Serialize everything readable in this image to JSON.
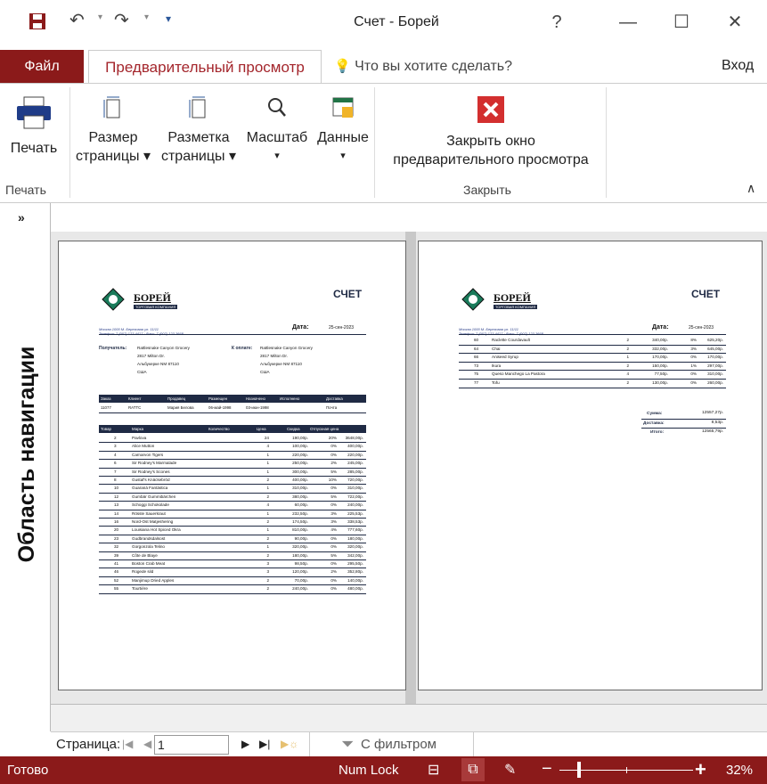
{
  "window": {
    "title": "Счет - Борей",
    "help": "?"
  },
  "tabs": {
    "file": "Файл",
    "preview": "Предварительный просмотр",
    "tell": "Что вы хотите сделать?",
    "signin": "Вход"
  },
  "ribbon": {
    "print": "Печать",
    "size_l1": "Размер",
    "size_l2": "страницы ▾",
    "layout_l1": "Разметка",
    "layout_l2": "страницы ▾",
    "zoom": "Масштаб",
    "data": "Данные",
    "close_l1": "Закрыть окно",
    "close_l2": "предварительного просмотра",
    "group_print": "Печать",
    "group_close": "Закрыть"
  },
  "nav_pane": {
    "label": "Область навигации",
    "toggle": "»"
  },
  "report": {
    "company": "БОРЕЙ",
    "company_sub": "ТОРГОВАЯ КОМПАНИЯ",
    "doc_title": "СЧЕТ",
    "address": "Москва 1000 М. Березовая ул. 11/11",
    "phone": "Телефон: 7 (007) 123 4417 · Факс: 7 (007) 123 3668",
    "date_label": "Дата:",
    "date": "25-сен-2023",
    "ship_label": "Получатель:",
    "bill_label": "К оплате:",
    "customer": [
      "Rattlesnake Canyon Grocery",
      "2817 Milton Dr.",
      "Альбукерке NM 87110",
      "США"
    ],
    "order_headers": [
      "Заказ",
      "Клиент",
      "Продавец",
      "Размещен",
      "Назначено",
      "Исполнено",
      "Доставка"
    ],
    "order_values": [
      "11077",
      "RATTC",
      "Мария Белова",
      "06-май-1998",
      "03-июн-1998",
      "",
      "Почта"
    ],
    "item_headers": [
      "Товар",
      "Марка",
      "Количество",
      "Цена",
      "Скидка",
      "Отпускная цена"
    ],
    "items_p1": [
      [
        "2",
        "Pavlova",
        "24",
        "190,00р.",
        "20%",
        "3648,00р."
      ],
      [
        "3",
        "Alice Mutton",
        "4",
        "100,00р.",
        "0%",
        "400,00р."
      ],
      [
        "4",
        "Carnarvon Tigers",
        "1",
        "220,00р.",
        "0%",
        "220,00р."
      ],
      [
        "6",
        "Sir Rodney's Marmalade",
        "1",
        "250,00р.",
        "2%",
        "245,00р."
      ],
      [
        "7",
        "Sir Rodney's Scones",
        "1",
        "300,00р.",
        "5%",
        "285,00р."
      ],
      [
        "8",
        "Gustaf's Knäckebröd",
        "2",
        "400,00р.",
        "10%",
        "720,00р."
      ],
      [
        "10",
        "Guaraná Fantástica",
        "1",
        "310,00р.",
        "0%",
        "310,00р."
      ],
      [
        "12",
        "Gumbär Gummibärchen",
        "2",
        "380,00р.",
        "5%",
        "722,00р."
      ],
      [
        "13",
        "Schoggi Schokolade",
        "4",
        "60,00р.",
        "0%",
        "240,00р."
      ],
      [
        "14",
        "Rössle Sauerkraut",
        "1",
        "232,50р.",
        "3%",
        "225,53р."
      ],
      [
        "16",
        "Nord-Ost Matjeshering",
        "2",
        "174,50р.",
        "3%",
        "338,53р."
      ],
      [
        "20",
        "Louisiana Hot Spiced Okra",
        "1",
        "810,00р.",
        "4%",
        "777,60р."
      ],
      [
        "23",
        "Gudbrandsdalsost",
        "2",
        "90,00р.",
        "0%",
        "180,00р."
      ],
      [
        "32",
        "Gorgonzola Telino",
        "1",
        "320,00р.",
        "0%",
        "320,00р."
      ],
      [
        "39",
        "Côte de Blaye",
        "2",
        "180,00р.",
        "5%",
        "342,00р."
      ],
      [
        "41",
        "Boston Crab Meat",
        "3",
        "98,50р.",
        "0%",
        "295,50р."
      ],
      [
        "46",
        "Rogede sild",
        "3",
        "120,00р.",
        "2%",
        "352,80р."
      ],
      [
        "52",
        "Manjimup Dried Apples",
        "2",
        "70,00р.",
        "0%",
        "140,00р."
      ],
      [
        "55",
        "Tourtière",
        "2",
        "240,00р.",
        "0%",
        "480,00р."
      ]
    ],
    "items_p2": [
      [
        "60",
        "Raclette Courdavault",
        "2",
        "340,00р.",
        "8%",
        "625,20р."
      ],
      [
        "64",
        "Chai",
        "2",
        "332,00р.",
        "3%",
        "645,00р."
      ],
      [
        "66",
        "Aniseed Syrup",
        "1",
        "170,00р.",
        "0%",
        "170,00р."
      ],
      [
        "73",
        "Ikura",
        "2",
        "150,00р.",
        "1%",
        "297,00р."
      ],
      [
        "75",
        "Queso Manchego La Pastora",
        "4",
        "77,50р.",
        "0%",
        "310,00р."
      ],
      [
        "77",
        "Tofu",
        "2",
        "130,00р.",
        "0%",
        "260,00р."
      ]
    ],
    "sum_label": "Сумма:",
    "sum": "12557,27р.",
    "ship_cost_label": "Доставка:",
    "ship_cost": "8,53р.",
    "total_label": "Итого:",
    "total": "12565,79р."
  },
  "pager": {
    "label": "Страница:",
    "current": "1",
    "filter": "С фильтром"
  },
  "status": {
    "ready": "Готово",
    "numlock": "Num Lock",
    "zoom": "32%"
  }
}
